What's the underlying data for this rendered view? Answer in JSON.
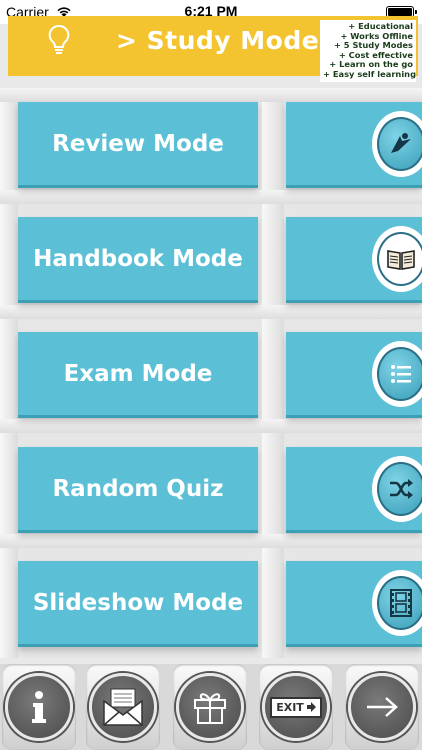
{
  "status_bar": {
    "carrier": "Carrier",
    "time": "6:21 PM"
  },
  "header": {
    "title": "> Study Modes",
    "features": [
      "+ Educational",
      "+ Works Offline",
      "+ 5 Study Modes",
      "+ Cost effective",
      "+ Learn on the go",
      "+ Easy self learning"
    ]
  },
  "modes": [
    {
      "label": "Review Mode",
      "icon": "review-icon"
    },
    {
      "label": "Handbook Mode",
      "icon": "book-icon"
    },
    {
      "label": "Exam Mode",
      "icon": "list-icon"
    },
    {
      "label": "Random Quiz",
      "icon": "shuffle-icon"
    },
    {
      "label": "Slideshow Mode",
      "icon": "film-icon"
    }
  ],
  "toolbar": {
    "buttons": [
      {
        "icon": "info-icon"
      },
      {
        "icon": "mail-icon"
      },
      {
        "icon": "gift-icon"
      },
      {
        "icon": "exit-icon",
        "label": "EXIT"
      },
      {
        "icon": "arrow-right-icon"
      }
    ]
  },
  "colors": {
    "accent": "#5bbfd6",
    "banner": "#f4c430",
    "toolbar_icon": "#4a4a4a"
  }
}
